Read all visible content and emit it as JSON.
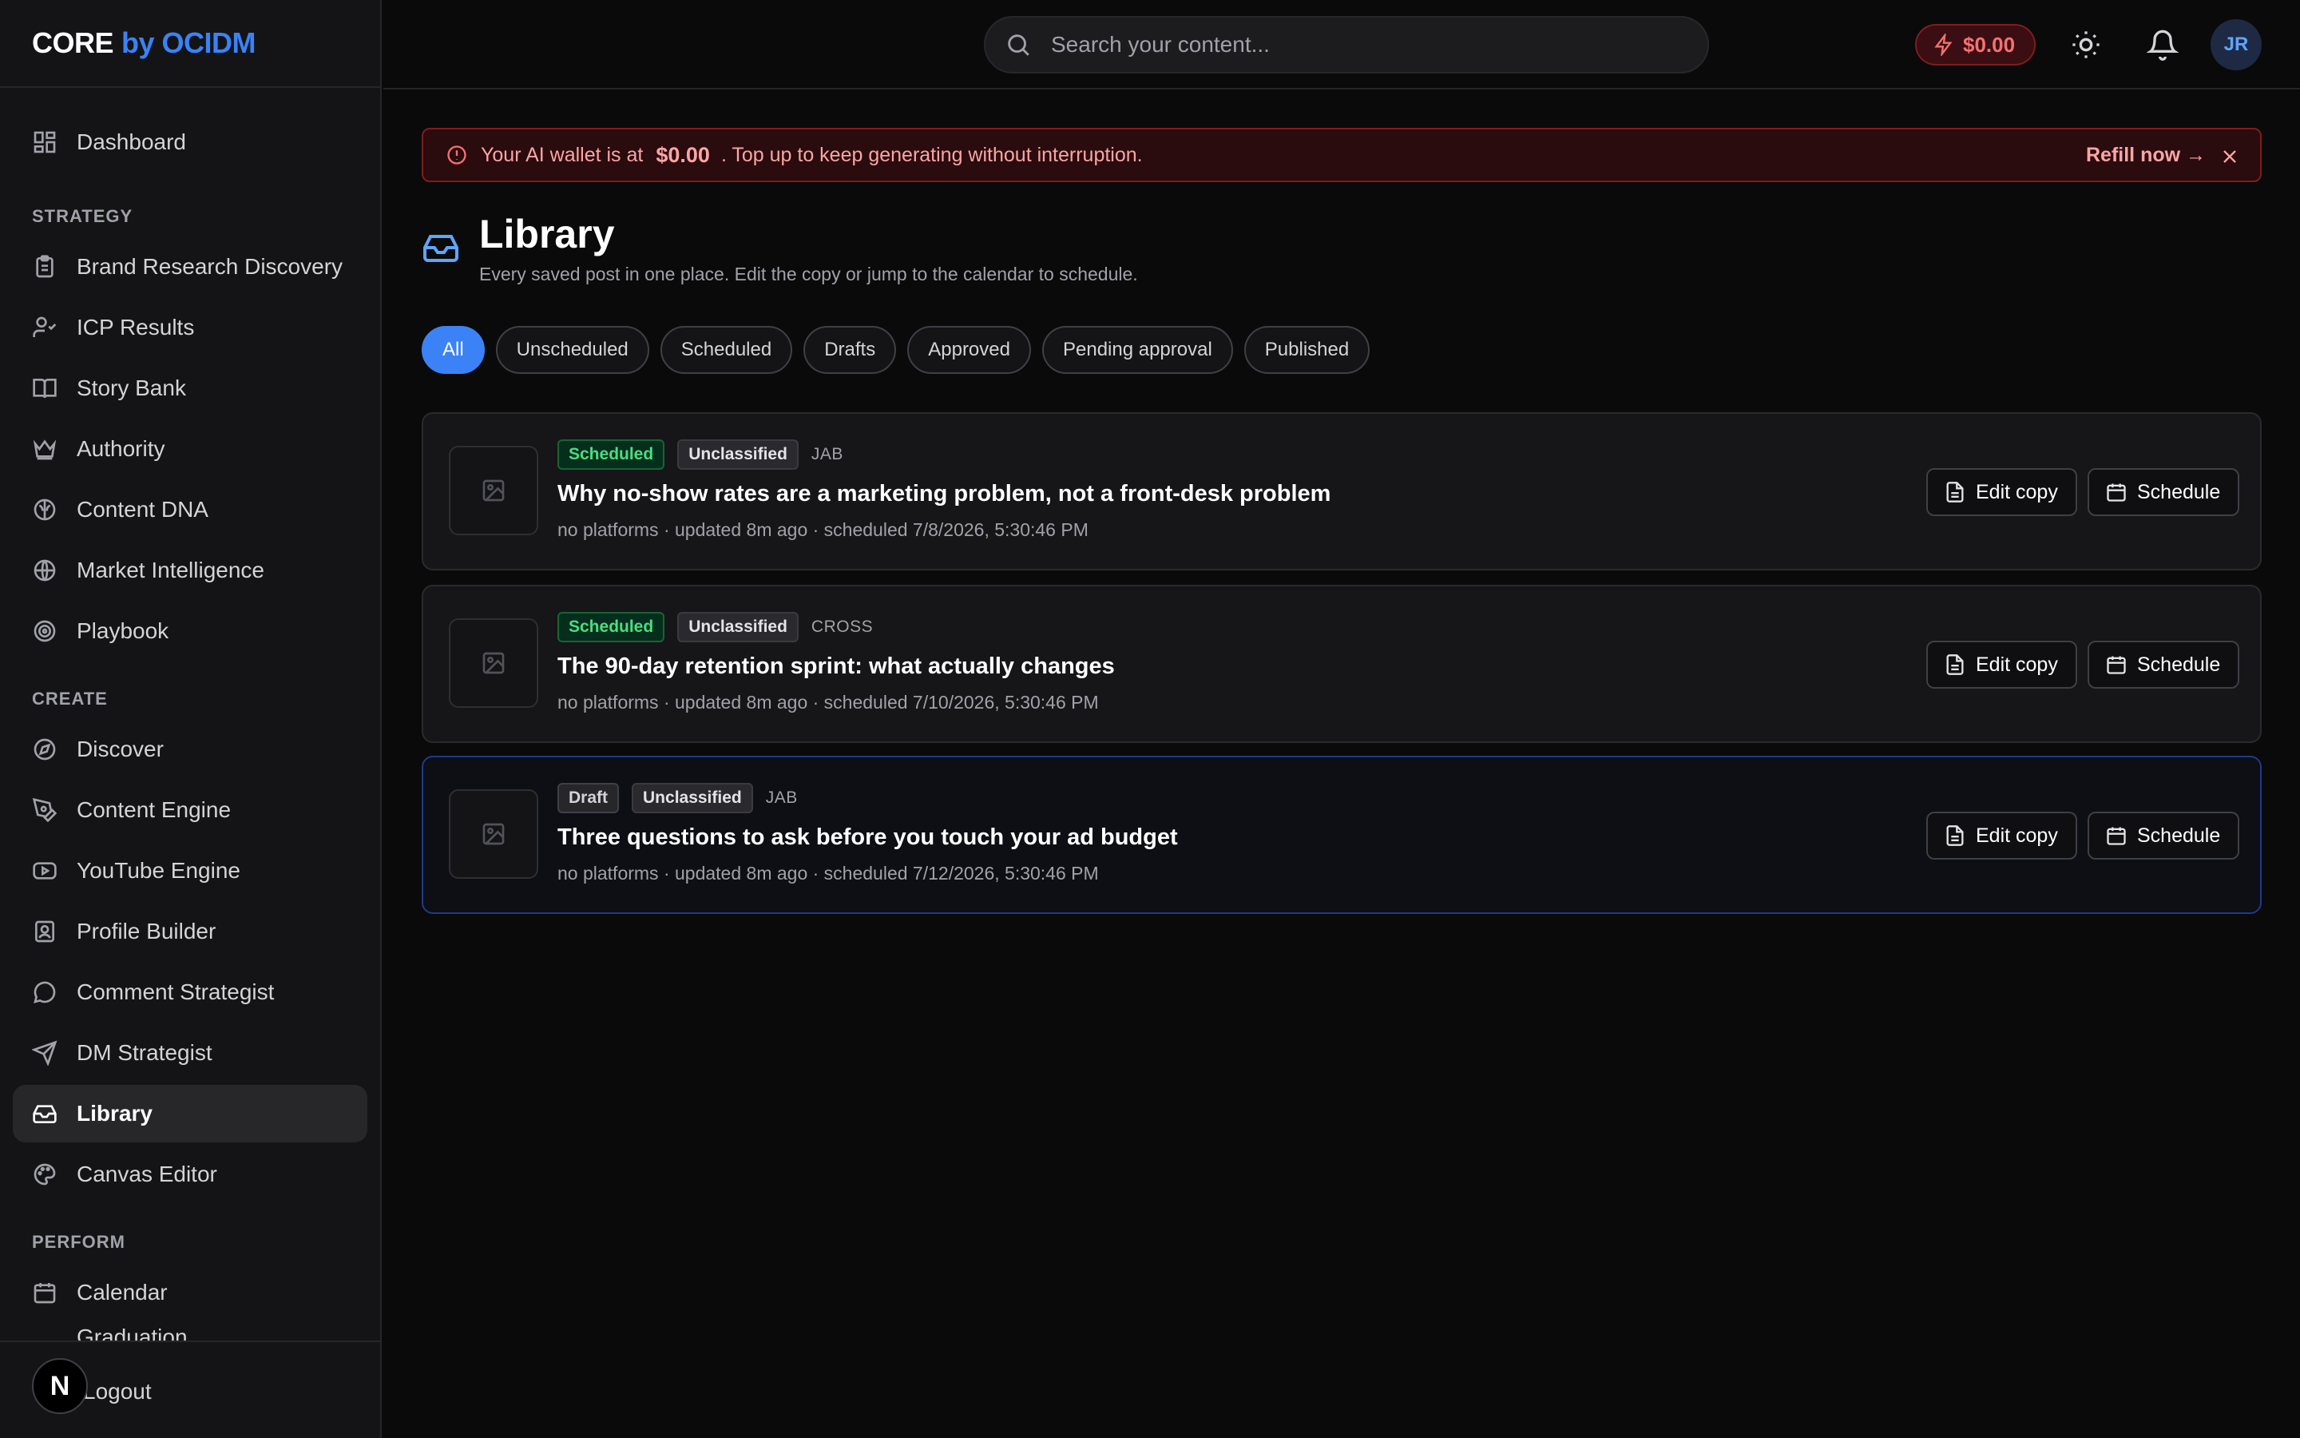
{
  "brand": {
    "core": "CORE",
    "by": "by OCIDM"
  },
  "sidebar": {
    "dashboard": "Dashboard",
    "sections": {
      "strategy": "STRATEGY",
      "create": "CREATE",
      "perform": "PERFORM"
    },
    "strategy_items": [
      {
        "label": "Brand Research Discovery",
        "icon": "clipboard-icon"
      },
      {
        "label": "ICP Results",
        "icon": "user-check-icon"
      },
      {
        "label": "Story Bank",
        "icon": "book-open-icon"
      },
      {
        "label": "Authority",
        "icon": "crown-icon"
      },
      {
        "label": "Content DNA",
        "icon": "brain-icon"
      },
      {
        "label": "Market Intelligence",
        "icon": "globe-icon"
      },
      {
        "label": "Playbook",
        "icon": "target-icon"
      }
    ],
    "create_items": [
      {
        "label": "Discover",
        "icon": "compass-icon"
      },
      {
        "label": "Content Engine",
        "icon": "pen-tool-icon"
      },
      {
        "label": "YouTube Engine",
        "icon": "youtube-icon"
      },
      {
        "label": "Profile Builder",
        "icon": "contact-icon"
      },
      {
        "label": "Comment Strategist",
        "icon": "message-circle-icon"
      },
      {
        "label": "DM Strategist",
        "icon": "send-icon"
      },
      {
        "label": "Library",
        "icon": "inbox-icon",
        "active": true
      },
      {
        "label": "Canvas Editor",
        "icon": "palette-icon"
      }
    ],
    "perform_items": [
      {
        "label": "Calendar",
        "icon": "calendar-icon"
      },
      {
        "label": "Graduation",
        "icon": "trend-icon"
      }
    ],
    "logout": "Logout",
    "n_badge": "N"
  },
  "header": {
    "search_placeholder": "Search your content...",
    "wallet": "$0.00",
    "avatar": "JR"
  },
  "alert": {
    "prefix": "Your AI wallet is at",
    "amount": "$0.00",
    "suffix": ". Top up to keep generating without interruption.",
    "refill": "Refill now →"
  },
  "page": {
    "title": "Library",
    "subtitle": "Every saved post in one place. Edit the copy or jump to the calendar to schedule."
  },
  "filters": [
    "All",
    "Unscheduled",
    "Scheduled",
    "Drafts",
    "Approved",
    "Pending approval",
    "Published"
  ],
  "active_filter": "All",
  "posts": [
    {
      "status": "Scheduled",
      "category": "Unclassified",
      "code": "JAB",
      "title": "Why no-show rates are a marketing problem, not a front-desk problem",
      "meta": "no platforms · updated 8m ago · scheduled 7/8/2026, 5:30:46 PM"
    },
    {
      "status": "Scheduled",
      "category": "Unclassified",
      "code": "CROSS",
      "title": "The 90-day retention sprint: what actually changes",
      "meta": "no platforms · updated 8m ago · scheduled 7/10/2026, 5:30:46 PM"
    },
    {
      "status": "Draft",
      "category": "Unclassified",
      "code": "JAB",
      "title": "Three questions to ask before you touch your ad budget",
      "meta": "no platforms · updated 8m ago · scheduled 7/12/2026, 5:30:46 PM"
    }
  ],
  "actions": {
    "edit": "Edit copy",
    "schedule": "Schedule"
  },
  "colors": {
    "accent": "#3b82f6",
    "danger": "#f87171",
    "success": "#4ade80"
  }
}
